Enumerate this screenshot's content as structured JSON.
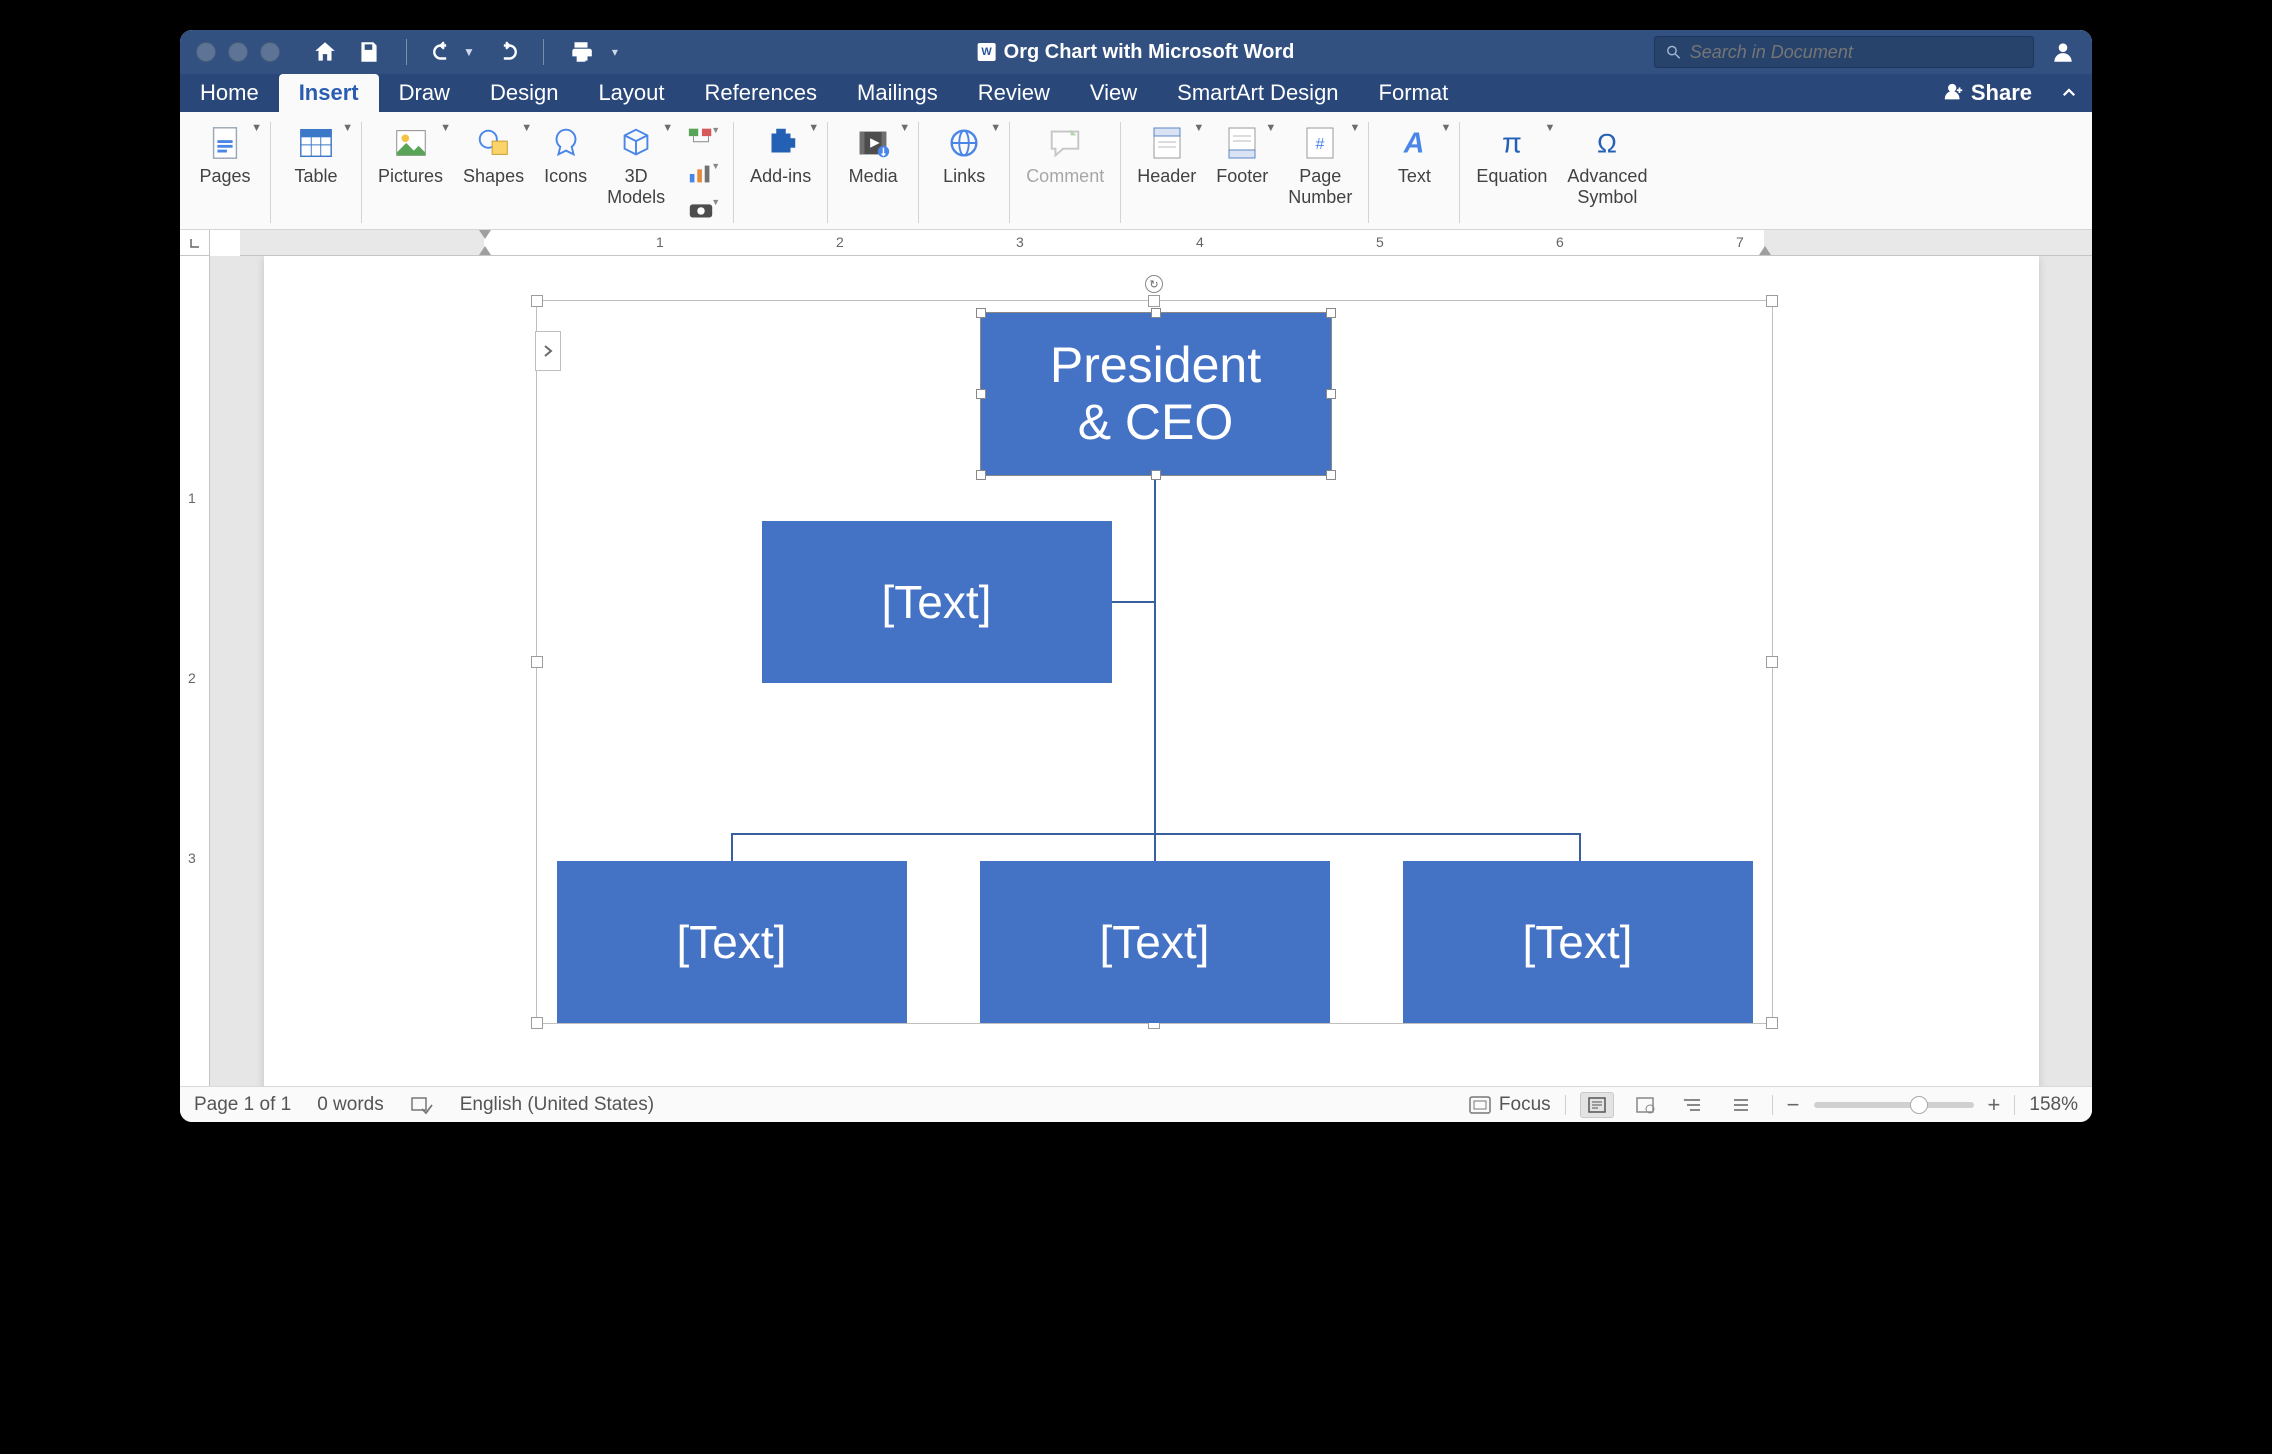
{
  "window": {
    "title": "Org Chart with Microsoft Word",
    "search_placeholder": "Search in Document"
  },
  "tabs": {
    "items": [
      "Home",
      "Insert",
      "Draw",
      "Design",
      "Layout",
      "References",
      "Mailings",
      "Review",
      "View"
    ],
    "context": [
      "SmartArt Design",
      "Format"
    ],
    "active": "Insert",
    "share": "Share"
  },
  "ribbon": {
    "pages": "Pages",
    "table": "Table",
    "pictures": "Pictures",
    "shapes": "Shapes",
    "icons": "Icons",
    "models3d": "3D\nModels",
    "addins": "Add-ins",
    "media": "Media",
    "links": "Links",
    "comment": "Comment",
    "header": "Header",
    "footer": "Footer",
    "pagenum": "Page\nNumber",
    "text": "Text",
    "equation": "Equation",
    "advsym": "Advanced\nSymbol"
  },
  "org": {
    "root": "President\n& CEO",
    "assistant": "[Text]",
    "child1": "[Text]",
    "child2": "[Text]",
    "child3": "[Text]"
  },
  "status": {
    "page": "Page 1 of 1",
    "words": "0 words",
    "lang": "English (United States)",
    "focus": "Focus",
    "zoom": "158%"
  },
  "ruler": {
    "h": [
      "1",
      "2",
      "3",
      "4",
      "5",
      "6",
      "7"
    ],
    "v": [
      "1",
      "2",
      "3"
    ]
  },
  "chart_data": {
    "type": "diagram",
    "layout": "organization-hierarchy",
    "nodes": [
      {
        "id": "root",
        "label": "President & CEO",
        "level": 0,
        "selected": true
      },
      {
        "id": "assist",
        "label": "[Text]",
        "level": 1,
        "role": "assistant"
      },
      {
        "id": "c1",
        "label": "[Text]",
        "level": 2
      },
      {
        "id": "c2",
        "label": "[Text]",
        "level": 2
      },
      {
        "id": "c3",
        "label": "[Text]",
        "level": 2
      }
    ],
    "edges": [
      {
        "from": "root",
        "to": "assist"
      },
      {
        "from": "root",
        "to": "c1"
      },
      {
        "from": "root",
        "to": "c2"
      },
      {
        "from": "root",
        "to": "c3"
      }
    ]
  }
}
